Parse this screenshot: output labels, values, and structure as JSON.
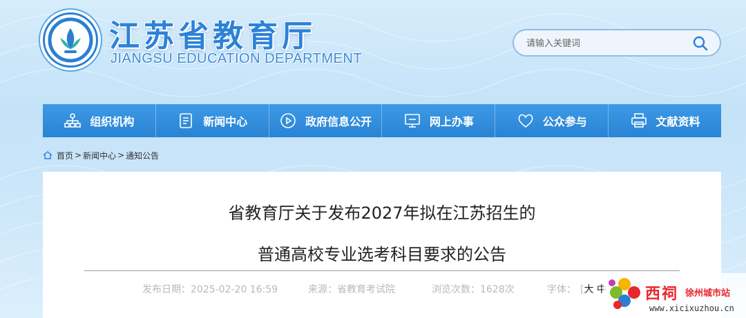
{
  "header": {
    "title": "江苏省教育厅",
    "subtitle": "JIANGSU EDUCATION DEPARTMENT",
    "search_placeholder": "请输入关键词",
    "logo_icon": "department-emblem-icon"
  },
  "nav": {
    "items": [
      {
        "label": "组织机构",
        "icon": "org-chart-icon"
      },
      {
        "label": "新闻中心",
        "icon": "document-icon"
      },
      {
        "label": "政府信息公开",
        "icon": "play-circle-icon"
      },
      {
        "label": "网上办事",
        "icon": "monitor-icon"
      },
      {
        "label": "公众参与",
        "icon": "heart-icon"
      },
      {
        "label": "文献资料",
        "icon": "printer-icon"
      }
    ]
  },
  "breadcrumb": {
    "home": "首页",
    "news": "新闻中心",
    "notice": "通知公告",
    "sep": ">"
  },
  "article": {
    "title_line1": "省教育厅关于发布2027年拟在江苏招生的",
    "title_line2": "普通高校专业选考科目要求的公告",
    "publish_date": "发布日期：2025-02-20 16:59",
    "source": "来源：省教育考试院",
    "views": "浏览次数：1628次",
    "font_size_label": "字体：",
    "font_large": "大",
    "font_medium": "中"
  },
  "watermark": {
    "name": "西祠",
    "city": "徐州城市站",
    "url": "www.xicixuzhou.cn"
  },
  "colors": {
    "nav_bg": "#2a83d4",
    "title_blue": "#2c82d8",
    "watermark_red": "#e8262e"
  }
}
